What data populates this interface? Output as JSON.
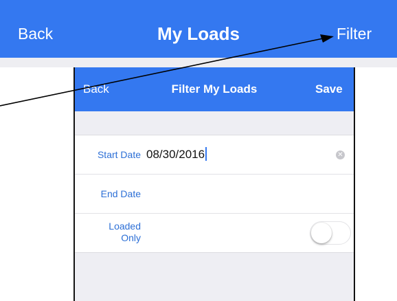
{
  "main_nav": {
    "back_label": "Back",
    "title": "My Loads",
    "filter_label": "Filter"
  },
  "filter_screen": {
    "nav": {
      "back_label": "Back",
      "title": "Filter My Loads",
      "save_label": "Save"
    },
    "fields": {
      "start_date_label": "Start Date",
      "start_date_value": "08/30/2016",
      "end_date_label": "End Date",
      "end_date_value": "",
      "loaded_only_label": "Loaded Only",
      "loaded_only_on": false
    }
  },
  "colors": {
    "accent": "#3478f0",
    "label": "#2c6fd6"
  },
  "icons": {
    "clear": "clear-circle-icon",
    "annotation": "annotation-arrow"
  }
}
